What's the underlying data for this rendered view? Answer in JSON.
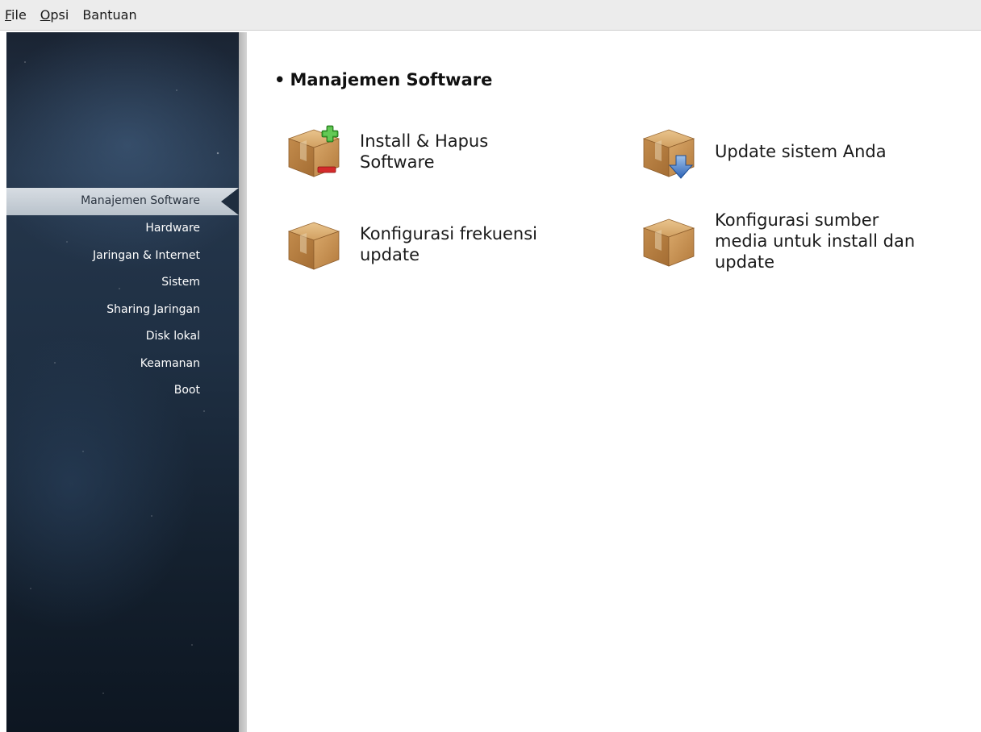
{
  "menubar": {
    "items": [
      {
        "mnemonic": "F",
        "rest": "ile"
      },
      {
        "mnemonic": "O",
        "rest": "psi"
      },
      {
        "mnemonic": "",
        "rest": "Bantuan"
      }
    ]
  },
  "sidebar": {
    "items": [
      {
        "label": "Manajemen Software",
        "active": true
      },
      {
        "label": "Hardware"
      },
      {
        "label": "Jaringan & Internet"
      },
      {
        "label": "Sistem"
      },
      {
        "label": "Sharing Jaringan"
      },
      {
        "label": "Disk lokal"
      },
      {
        "label": "Keamanan"
      },
      {
        "label": "Boot"
      }
    ]
  },
  "main": {
    "title": "Manajemen Software",
    "bullet": "•",
    "tools": [
      {
        "label_line1": "Install & Hapus",
        "label_line2": "Software",
        "icon": "package-add-remove-icon"
      },
      {
        "label_line1": "Update sistem Anda",
        "label_line2": "",
        "icon": "package-update-icon"
      },
      {
        "label_line1": "Konfigurasi frekuensi",
        "label_line2": "update",
        "icon": "package-icon"
      },
      {
        "label_line1": "Konfigurasi sumber",
        "label_line2": "media untuk install dan",
        "label_line3": "update",
        "icon": "package-icon"
      }
    ]
  },
  "colors": {
    "sidebar_bg": "#1f3044",
    "active_item_bg": "#c8d0d8",
    "box_brown": "#c8914f"
  }
}
